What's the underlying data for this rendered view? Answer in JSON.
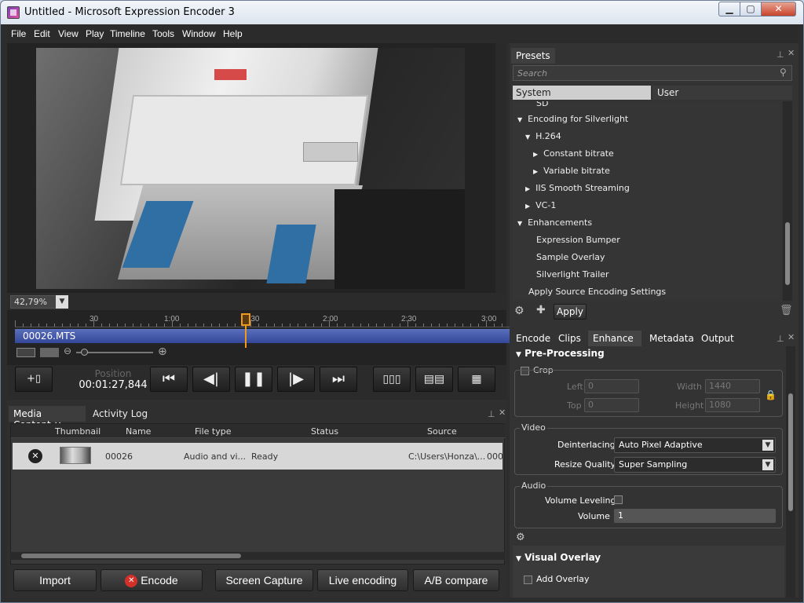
{
  "window": {
    "title": "Untitled - Microsoft Expression Encoder 3",
    "min": "▁",
    "max": "▢",
    "close": "✕"
  },
  "menu": [
    "File",
    "Edit",
    "View",
    "Play",
    "Timeline",
    "Tools",
    "Window",
    "Help"
  ],
  "preview": {
    "zoom": "42,79%"
  },
  "timeline": {
    "ticks": [
      "30",
      "1:00",
      "1:30",
      "2:00",
      "2:30",
      "3:00"
    ],
    "clip_name": "00026.MTS"
  },
  "transport": {
    "position_label": "Position",
    "position_value": "00:01:27,844"
  },
  "media_content": {
    "tabs": [
      "Media Content",
      "Activity Log"
    ],
    "columns": [
      "Thumbnail",
      "Name",
      "File type",
      "Status",
      "Source"
    ],
    "rows": [
      {
        "name": "00026",
        "file_type": "Audio and vi...",
        "status": "Ready",
        "source": "C:\\Users\\Honza\\...",
        "extra": "000"
      }
    ]
  },
  "bottom_buttons": {
    "import": "Import",
    "encode": "Encode",
    "screen_capture": "Screen Capture",
    "live_encoding": "Live encoding",
    "ab_compare": "A/B compare"
  },
  "presets": {
    "title": "Presets",
    "search_placeholder": "Search",
    "tabs": [
      "System",
      "User"
    ],
    "tree": [
      {
        "label": "SD",
        "indent": 1,
        "arrow": ""
      },
      {
        "label": "Encoding for Silverlight",
        "indent": 0,
        "arrow": "▼"
      },
      {
        "label": "H.264",
        "indent": 1,
        "arrow": "▼"
      },
      {
        "label": "Constant bitrate",
        "indent": 2,
        "arrow": "▶"
      },
      {
        "label": "Variable bitrate",
        "indent": 2,
        "arrow": "▶"
      },
      {
        "label": "IIS Smooth Streaming",
        "indent": 1,
        "arrow": "▶"
      },
      {
        "label": "VC-1",
        "indent": 1,
        "arrow": "▶"
      },
      {
        "label": "Enhancements",
        "indent": 0,
        "arrow": "▼"
      },
      {
        "label": "Expression Bumper",
        "indent": 1,
        "arrow": ""
      },
      {
        "label": "Sample Overlay",
        "indent": 1,
        "arrow": ""
      },
      {
        "label": "Silverlight Trailer",
        "indent": 1,
        "arrow": ""
      },
      {
        "label": "Apply Source Encoding Settings",
        "indent": 0,
        "arrow": ""
      }
    ],
    "apply": "Apply"
  },
  "right_tabs": [
    "Encode",
    "Clips",
    "Enhance",
    "Metadata",
    "Output"
  ],
  "enhance": {
    "preprocessing": "Pre-Processing",
    "crop": "Crop",
    "left_label": "Left",
    "left_value": "0",
    "top_label": "Top",
    "top_value": "0",
    "width_label": "Width",
    "width_value": "1440",
    "height_label": "Height",
    "height_value": "1080",
    "video_group": "Video",
    "deinterlacing_label": "Deinterlacing",
    "deinterlacing_value": "Auto Pixel Adaptive",
    "resize_label": "Resize Quality",
    "resize_value": "Super Sampling",
    "audio_group": "Audio",
    "volume_leveling_label": "Volume Leveling",
    "volume_label": "Volume",
    "volume_value": "1",
    "visual_overlay": "Visual Overlay",
    "add_overlay": "Add Overlay"
  }
}
